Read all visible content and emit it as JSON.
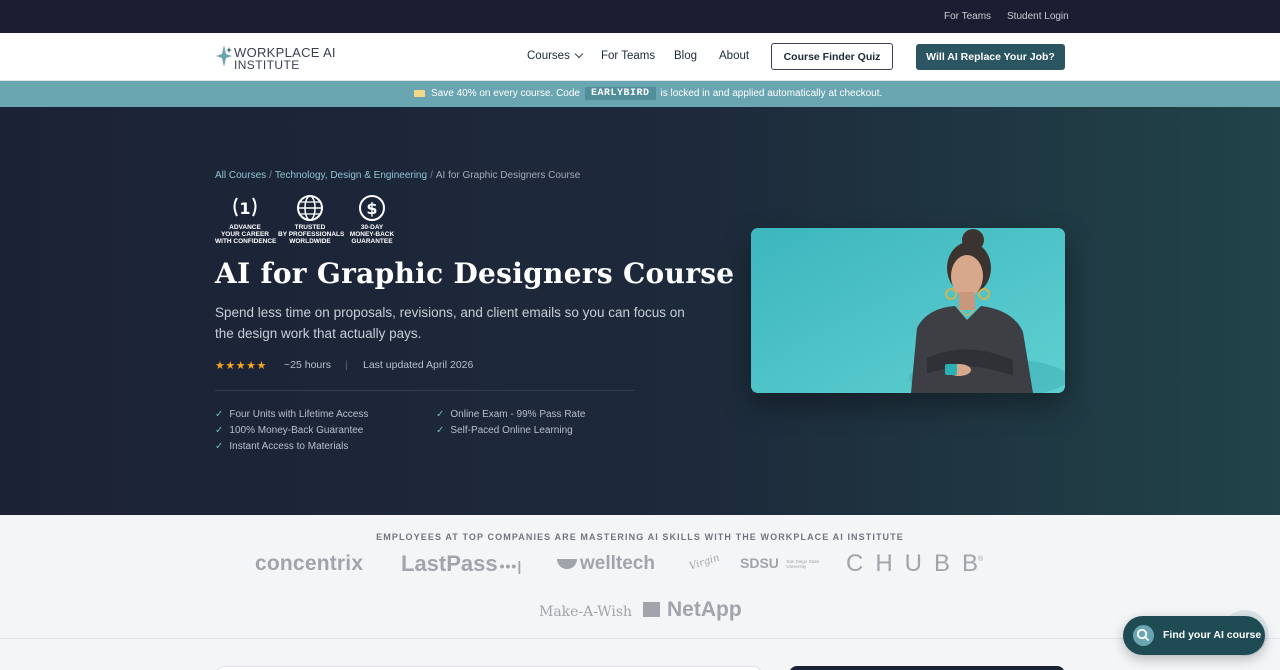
{
  "utility_bar": {
    "for_teams": "For Teams",
    "student_login": "Student Login"
  },
  "header": {
    "logo_line1": "WORKPLACE AI",
    "logo_line2": "INSTITUTE",
    "nav": {
      "courses": "Courses",
      "for_teams": "For Teams",
      "blog": "Blog",
      "about": "About"
    },
    "quiz_button": "Course Finder Quiz",
    "cta_button": "Will AI Replace Your Job?"
  },
  "promo": {
    "before": "Save 40% on every course. Code",
    "code": "EARLYBIRD",
    "after": "is locked in and applied automatically at checkout."
  },
  "hero": {
    "breadcrumb": [
      "All Courses",
      "Technology, Design & Engineering",
      "AI for Graphic Designers Course"
    ],
    "breadcrumb_sep": "/",
    "badges": [
      {
        "symbol": "1",
        "lines": [
          "ADVANCE",
          "YOUR CAREER",
          "WITH CONFIDENCE"
        ]
      },
      {
        "symbol": "globe",
        "lines": [
          "TRUSTED",
          "BY PROFESSIONALS",
          "WORLDWIDE"
        ]
      },
      {
        "symbol": "$",
        "lines": [
          "30-DAY",
          "MONEY-BACK",
          "GUARANTEE"
        ]
      }
    ],
    "title": "AI for Graphic Designers Course",
    "subtitle": "Spend less time on proposals, revisions, and client emails so you can focus on the design work that actually pays.",
    "rating_stars": "★★★★★",
    "duration": "~25 hours",
    "meta_divider": "|",
    "last_updated": "Last updated April 2026",
    "features_left": [
      "Four Units with Lifetime Access",
      "100% Money-Back Guarantee",
      "Instant Access to Materials"
    ],
    "features_right": [
      "Online Exam - 99% Pass Rate",
      "Self-Paced Online Learning"
    ],
    "check_glyph": "✓"
  },
  "logos": {
    "heading": "EMPLOYEES AT TOP COMPANIES ARE MASTERING AI SKILLS WITH THE WORKPLACE AI INSTITUTE",
    "concentrix": "concentrix",
    "lastpass": "LastPass",
    "lastpass_dots": "•••|",
    "welltech": "welltech",
    "virgin": "Virgin",
    "sdsu": "SDSU",
    "sdsu_sub": "San Diego State University",
    "chubb": "CHUBB",
    "chubb_mark": "®",
    "makeawish": "Make-A-Wish",
    "netapp": "NetApp"
  },
  "fab": {
    "label": "Find your AI course",
    "icon": "search-icon"
  },
  "colors": {
    "accent": "#2a5561",
    "banner": "#6aa6b1",
    "hero_bg": "#1c2236",
    "star": "#f5a524",
    "image_bg": "#4fc3c9"
  }
}
